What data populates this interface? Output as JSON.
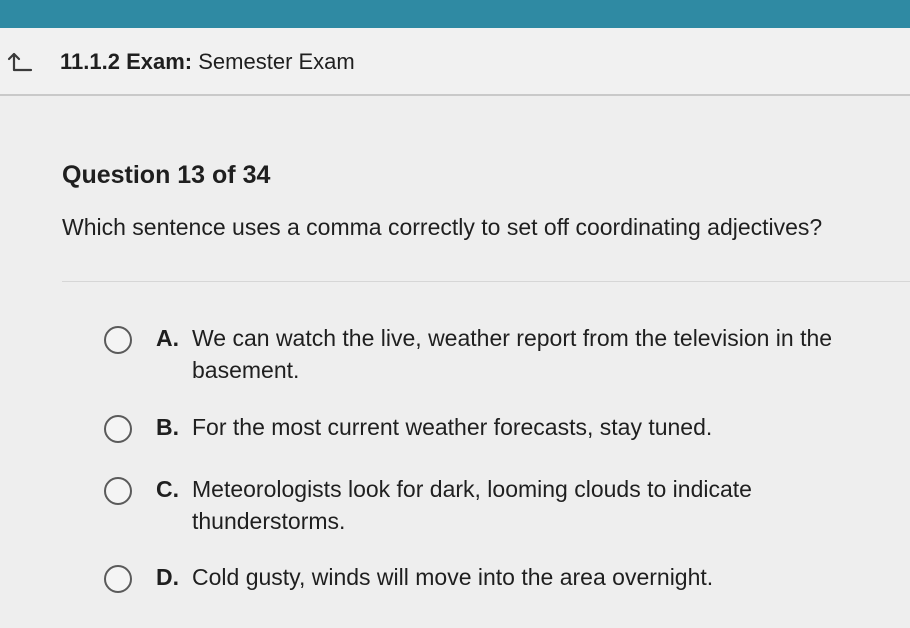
{
  "header": {
    "back_icon": "back-arrow-icon",
    "course_code": "11.1.2",
    "assessment_type": "Exam:",
    "assessment_title": "Semester Exam"
  },
  "question": {
    "number_label": "Question 13 of 34",
    "prompt": "Which sentence uses a comma correctly to set off coordinating adjectives?"
  },
  "options": [
    {
      "letter": "A.",
      "text": "We can watch the live, weather report from the television in the basement."
    },
    {
      "letter": "B.",
      "text": "For the most current weather forecasts, stay tuned."
    },
    {
      "letter": "C.",
      "text": "Meteorologists look for dark, looming clouds to indicate thunderstorms."
    },
    {
      "letter": "D.",
      "text": "Cold gusty, winds will move into the area overnight."
    }
  ],
  "colors": {
    "top_bar": "#2f8aa3",
    "background": "#eeeeee",
    "text": "#1f1f1f"
  }
}
